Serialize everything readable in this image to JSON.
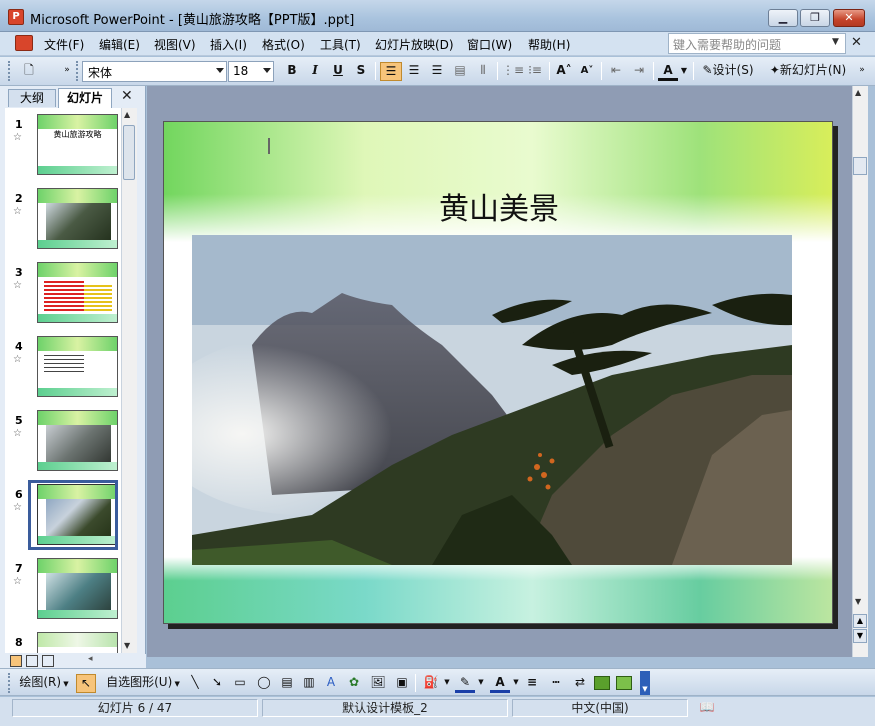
{
  "window": {
    "title": "Microsoft PowerPoint - [黄山旅游攻略【PPT版】.ppt]",
    "minimize": "▁",
    "restore": "❐",
    "close": "✕"
  },
  "menu": {
    "items": [
      "文件(F)",
      "编辑(E)",
      "视图(V)",
      "插入(I)",
      "格式(O)",
      "工具(T)",
      "幻灯片放映(D)",
      "窗口(W)",
      "帮助(H)"
    ],
    "help_placeholder": "键入需要帮助的问题",
    "help_close": "✕"
  },
  "toolbar": {
    "font_name": "宋体",
    "font_size": "18",
    "bold": "B",
    "italic": "I",
    "underline": "U",
    "shadow": "S",
    "grow_font": "A˄",
    "shrink_font": "A˅",
    "font_color": "A",
    "design_label": "设计(S)",
    "new_slide_label": "新幻灯片(N)"
  },
  "left_panel": {
    "tab_outline": "大纲",
    "tab_slides": "幻灯片",
    "close": "✕",
    "slides": [
      {
        "num": "1",
        "caption": "黄山旅游攻略"
      },
      {
        "num": "2",
        "caption": ""
      },
      {
        "num": "3",
        "caption": ""
      },
      {
        "num": "4",
        "caption": ""
      },
      {
        "num": "5",
        "caption": ""
      },
      {
        "num": "6",
        "caption": ""
      },
      {
        "num": "7",
        "caption": ""
      },
      {
        "num": "8",
        "caption": ""
      }
    ],
    "selected_slide": "6",
    "star": "☆"
  },
  "slide": {
    "title": "黄山美景"
  },
  "drawbar": {
    "draw_label": "绘图(R)",
    "autoshapes_label": "自选图形(U)"
  },
  "status": {
    "slide_position": "幻灯片 6 / 47",
    "template": "默认设计模板_2",
    "language": "中文(中国)"
  },
  "colors": {
    "titlebar": "#a9c3de",
    "workarea": "#8f9cb4",
    "selection": "#3a5c9c",
    "active_button": "#f7c47a"
  }
}
